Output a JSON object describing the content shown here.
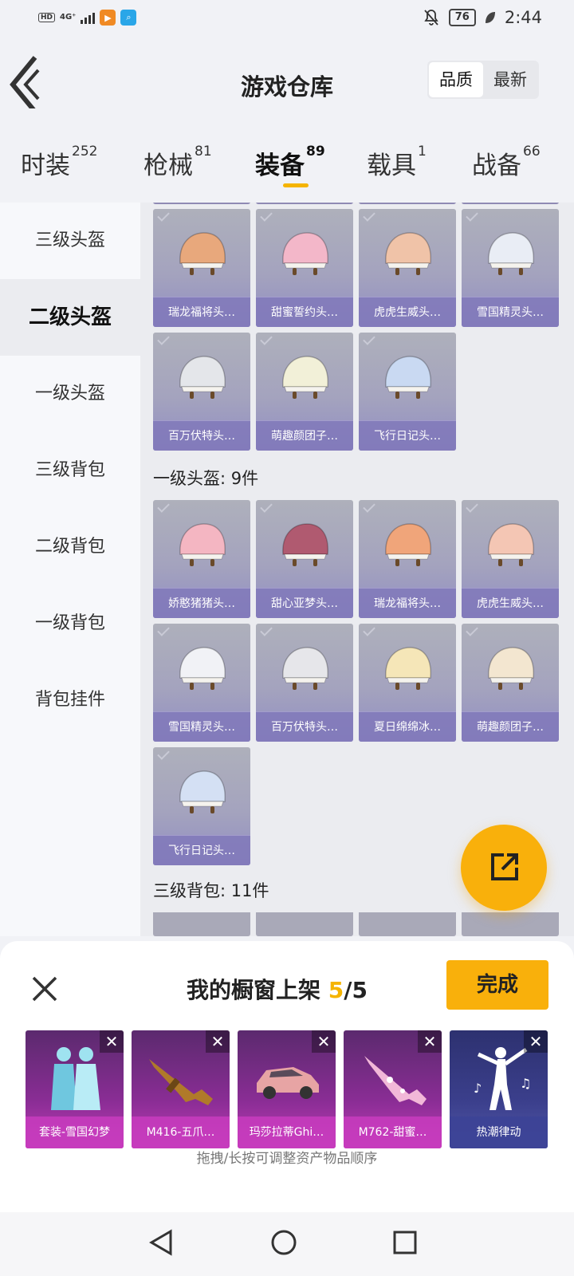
{
  "status_bar": {
    "hd": "HD",
    "network": "4G⁺",
    "battery": "76",
    "time": "2:44"
  },
  "header": {
    "title": "游戏仓库",
    "sort_quality": "品质",
    "sort_latest": "最新"
  },
  "tabs": [
    {
      "label": "时装",
      "count": "252"
    },
    {
      "label": "枪械",
      "count": "81"
    },
    {
      "label": "装备",
      "count": "89"
    },
    {
      "label": "载具",
      "count": "1"
    },
    {
      "label": "战备",
      "count": "66"
    }
  ],
  "sidebar": {
    "items": [
      {
        "label": "三级头盔"
      },
      {
        "label": "二级头盔"
      },
      {
        "label": "一级头盔"
      },
      {
        "label": "三级背包"
      },
      {
        "label": "二级背包"
      },
      {
        "label": "一级背包"
      },
      {
        "label": "背包挂件"
      }
    ]
  },
  "level2_helmets": [
    {
      "name": "瑞龙福将头…",
      "icon": "helmet-icon",
      "color": "#e8a87c"
    },
    {
      "name": "甜蜜誓约头…",
      "icon": "helmet-icon",
      "color": "#f3b7c9"
    },
    {
      "name": "虎虎生威头…",
      "icon": "helmet-icon",
      "color": "#f0c3a8"
    },
    {
      "name": "雪国精灵头…",
      "icon": "helmet-icon",
      "color": "#e9edf5"
    },
    {
      "name": "百万伏特头…",
      "icon": "helmet-icon",
      "color": "#e4e6ea"
    },
    {
      "name": "萌趣颜团子…",
      "icon": "helmet-icon",
      "color": "#f2f0d8"
    },
    {
      "name": "飞行日记头…",
      "icon": "helmet-icon",
      "color": "#c9d9f2"
    }
  ],
  "section_level1": {
    "title": "一级头盔: 9件"
  },
  "level1_helmets": [
    {
      "name": "娇憨猪猪头…",
      "icon": "helmet-icon",
      "color": "#f4b6c2"
    },
    {
      "name": "甜心亚梦头…",
      "icon": "helmet-icon",
      "color": "#b05a70"
    },
    {
      "name": "瑞龙福将头…",
      "icon": "helmet-icon",
      "color": "#f0a57a"
    },
    {
      "name": "虎虎生威头…",
      "icon": "helmet-icon",
      "color": "#f4c6b4"
    },
    {
      "name": "雪国精灵头…",
      "icon": "helmet-icon",
      "color": "#f1f2f6"
    },
    {
      "name": "百万伏特头…",
      "icon": "helmet-icon",
      "color": "#e6e6ea"
    },
    {
      "name": "夏日绵绵冰…",
      "icon": "helmet-icon",
      "color": "#f5e6b8"
    },
    {
      "name": "萌趣颜团子…",
      "icon": "helmet-icon",
      "color": "#f3e6d0"
    },
    {
      "name": "飞行日记头…",
      "icon": "helmet-icon",
      "color": "#d4e0f4"
    }
  ],
  "section_level3_bag": {
    "title": "三级背包: 11件"
  },
  "share_fab": {
    "icon": "share-export-icon"
  },
  "showcase": {
    "title_prefix": "我的橱窗上架",
    "count_current": "5",
    "count_total": "/5",
    "done_label": "完成",
    "items": [
      {
        "name": "套装-雪国幻梦",
        "icon": "outfit-icon"
      },
      {
        "name": "M416-五爪…",
        "icon": "rifle-icon"
      },
      {
        "name": "玛莎拉蒂Ghi…",
        "icon": "car-icon"
      },
      {
        "name": "M762-甜蜜…",
        "icon": "rifle-icon"
      },
      {
        "name": "热潮律动",
        "icon": "dance-emote-icon"
      }
    ],
    "remove_label": "✕",
    "hint": "拖拽/长按可调整资产物品顺序"
  }
}
